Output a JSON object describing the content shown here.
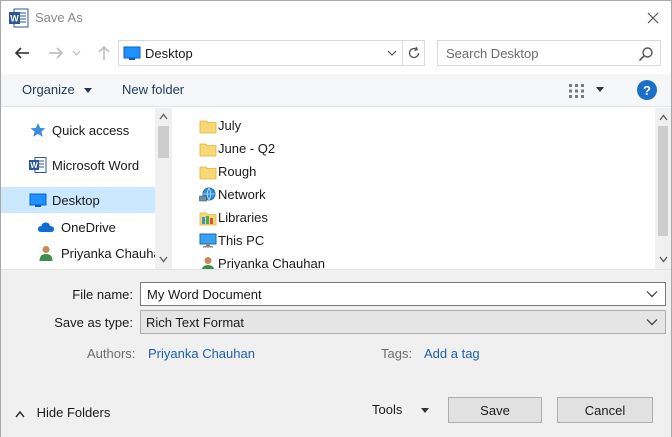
{
  "window": {
    "title": "Save As"
  },
  "address": {
    "path": "Desktop"
  },
  "search": {
    "placeholder": "Search Desktop"
  },
  "toolbar": {
    "organize_label": "Organize",
    "new_folder_label": "New folder",
    "help_label": "?"
  },
  "sidebar": {
    "items": [
      {
        "label": "Quick access",
        "icon": "star-icon"
      },
      {
        "label": "Microsoft Word",
        "icon": "word-icon"
      },
      {
        "label": "Desktop",
        "icon": "desktop-icon",
        "selected": true
      },
      {
        "label": "OneDrive",
        "icon": "cloud-icon"
      },
      {
        "label": "Priyanka Chauha",
        "icon": "user-icon"
      }
    ]
  },
  "files": [
    {
      "label": "July",
      "icon": "folder-icon"
    },
    {
      "label": "June - Q2",
      "icon": "folder-icon"
    },
    {
      "label": "Rough",
      "icon": "folder-icon"
    },
    {
      "label": "Network",
      "icon": "network-icon"
    },
    {
      "label": "Libraries",
      "icon": "libraries-icon"
    },
    {
      "label": "This PC",
      "icon": "computer-icon"
    },
    {
      "label": "Priyanka Chauhan",
      "icon": "user-icon"
    }
  ],
  "form": {
    "file_name_label": "File name:",
    "file_name_value": "My Word Document",
    "save_type_label": "Save as type:",
    "save_type_value": "Rich Text Format",
    "authors_label": "Authors:",
    "authors_value": "Priyanka Chauhan",
    "tags_label": "Tags:",
    "tags_value": "Add a tag"
  },
  "footer": {
    "hide_folders_label": "Hide Folders",
    "tools_label": "Tools",
    "save_label": "Save",
    "cancel_label": "Cancel"
  },
  "colors": {
    "accent": "#1a6fc9",
    "selection": "#cce8ff",
    "link": "#1d5fa8",
    "word_blue": "#2b5797",
    "folder": "#f8d775"
  }
}
